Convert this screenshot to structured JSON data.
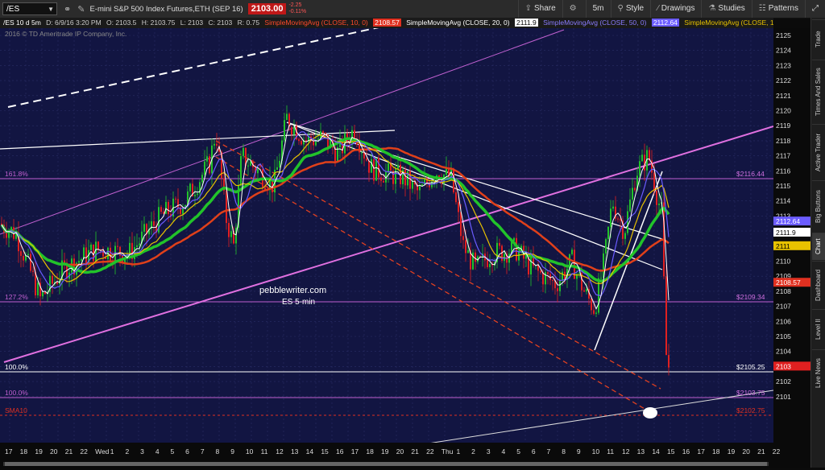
{
  "toolbar": {
    "symbol": "/ES",
    "title": "E-mini S&P 500 Index Futures,ETH (SEP 16)",
    "price": "2103.00",
    "change": "-2.25",
    "change_pct": "-0.11%",
    "buttons": [
      "Share",
      "5m",
      "Style",
      "Drawings",
      "Studies",
      "Patterns"
    ]
  },
  "infobar": {
    "period": "/ES 10 d 5m",
    "date": "D: 6/9/16 3:20 PM",
    "open": "O: 2103.5",
    "high": "H: 2103.75",
    "low": "L: 2103",
    "close": "C: 2103",
    "range": "R: 0.75",
    "sma10": "SimpleMovingAvg (CLOSE, 10, 0)",
    "sma10_val": "2108.57",
    "sma20": "SimpleMovingAvg (CLOSE, 20, 0)",
    "sma20_val": "2111.9",
    "sma50": "SimpleMovingAvg (CLOSE, 50, 0)",
    "sma50_val": "2112.64",
    "sma100": "SimpleMovingAvg (CLOSE, 100, 0)",
    "sma100_val": "2111"
  },
  "copyright": "2016 © TD Ameritrade IP Company, Inc.",
  "watermark": {
    "line1": "pebblewriter.com",
    "line2": "ES 5-min"
  },
  "fib_labels": {
    "f161": "161.8%",
    "f161_val": "$2116.44",
    "f127": "127.2%",
    "f127_val": "$2109.34",
    "f100a": "100.0%",
    "f100a_val": "$2105.25",
    "f100b": "100.0%",
    "f100b_val": "$2103.75",
    "sma": "SMA10",
    "sma_val": "$2102.75"
  },
  "price_tags": [
    {
      "label": "2112.64",
      "price": 2112.64,
      "color": "#6b5cff"
    },
    {
      "label": "2111.9",
      "price": 2111.9,
      "color": "#ffffff"
    },
    {
      "label": "2111",
      "price": 2111.0,
      "color": "#e8c200"
    },
    {
      "label": "2108.57",
      "price": 2108.57,
      "color": "#e03020"
    },
    {
      "label": "2103",
      "price": 2103.0,
      "color": "#e02020"
    }
  ],
  "yaxis": {
    "min": 2101,
    "max": 2125,
    "ticks": [
      2101,
      2102,
      2103,
      2104,
      2105,
      2106,
      2107,
      2108,
      2109,
      2110,
      2111,
      2112,
      2113,
      2114,
      2115,
      2116,
      2117,
      2118,
      2119,
      2120,
      2121,
      2122,
      2123,
      2124,
      2125
    ]
  },
  "xaxis": {
    "ticks": [
      "17",
      "18",
      "19",
      "20",
      "21",
      "22",
      "Wed",
      "1",
      "2",
      "3",
      "4",
      "5",
      "6",
      "7",
      "8",
      "9",
      "10",
      "11",
      "12",
      "13",
      "14",
      "15",
      "16",
      "17",
      "18",
      "19",
      "20",
      "21",
      "22",
      "Thu",
      "1",
      "2",
      "3",
      "4",
      "5",
      "6",
      "7",
      "8",
      "9",
      "10",
      "11",
      "12",
      "13",
      "14",
      "15",
      "16",
      "17",
      "18",
      "19",
      "20",
      "21",
      "22"
    ]
  },
  "sidebar": [
    "Trade",
    "Times And Sales",
    "Active Trader",
    "Big Buttons",
    "Chart",
    "Dashboard",
    "Level II",
    "Live News"
  ],
  "colors": {
    "background": "#121542",
    "sma10": "#ff3a1a",
    "sma20": "#ffffff",
    "sma50": "#6b5cff",
    "sma100": "#e8c200",
    "green_ma": "#22c32a",
    "red_ma": "#e0401a",
    "fib": "#c060d0",
    "up": "#22c32a",
    "down": "#e02020"
  }
}
